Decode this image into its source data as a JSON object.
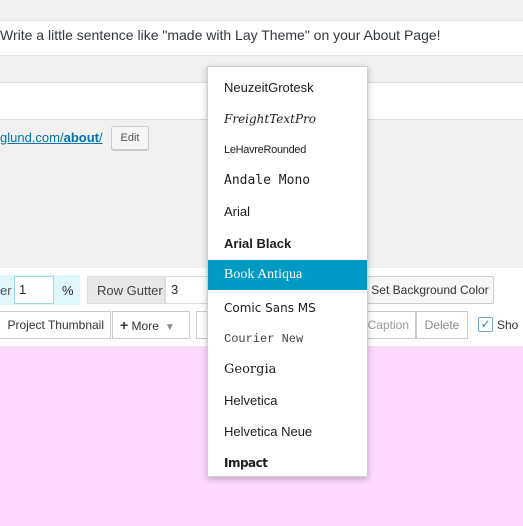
{
  "notice": {
    "text": "Write a little sentence like \"made with Lay Theme\" on your About Page!"
  },
  "permalink": {
    "prefix": "glund.com/",
    "slug": "about",
    "suffix": "/",
    "edit_label": "Edit"
  },
  "row_settings": {
    "percent_label": "er",
    "percent_value": "1",
    "percent_unit": "%",
    "gutter_label": "Row Gutter",
    "gutter_value": "3",
    "bg_color_label": "Set Background Color"
  },
  "editor_toolbar": {
    "thumbnail_label": "Project Thumbnail",
    "more_label": "More",
    "more_icon": "+",
    "caption_label": "Caption",
    "delete_label": "Delete",
    "show_label": "Sho",
    "show_checked": true
  },
  "font_dropdown": {
    "selected": "Book Antiqua",
    "items": [
      "NeuzeitGrotesk",
      "FreightTextPro",
      "LeHavreRounded",
      "Andale Mono",
      "Arial",
      "Arial Black",
      "Book Antiqua",
      "Comic Sans MS",
      "Courier New",
      "Georgia",
      "Helvetica",
      "Helvetica Neue",
      "Impact"
    ]
  },
  "colors": {
    "accent": "#009ac4",
    "link": "#0073aa",
    "grid_background": "#fdd9fd"
  }
}
